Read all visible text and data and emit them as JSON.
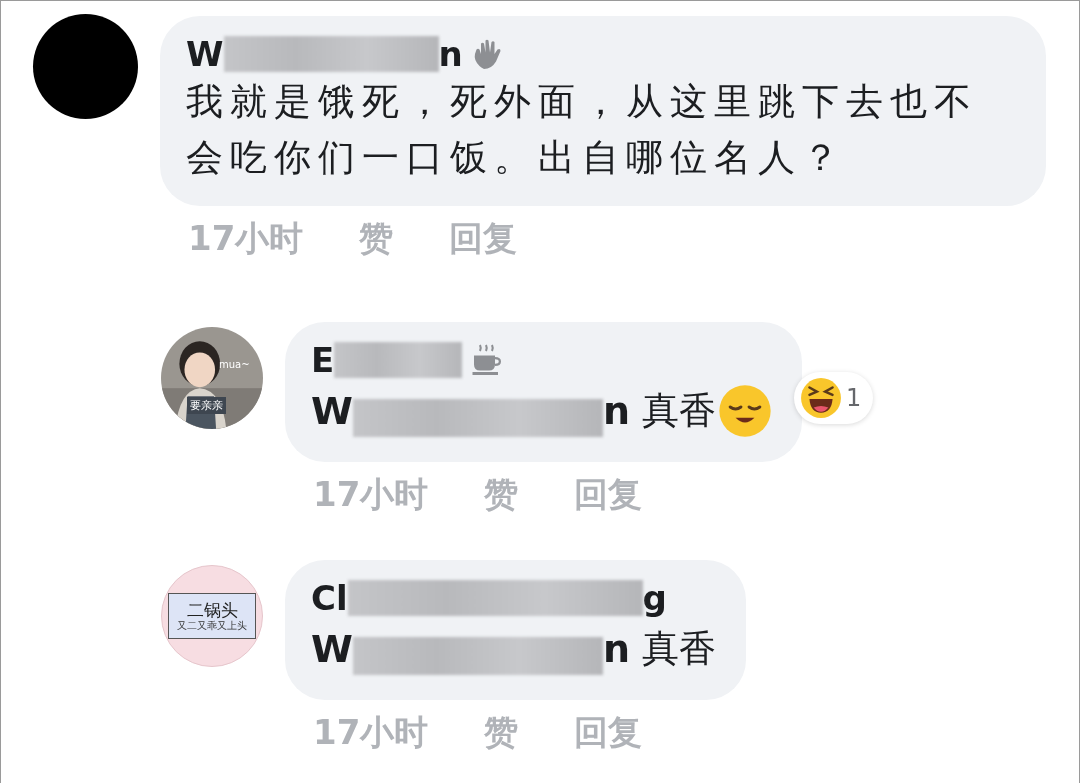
{
  "comments": [
    {
      "avatar": {
        "kind": "blank"
      },
      "reply": false,
      "name": {
        "start": "W",
        "end": "n"
      },
      "badge": {
        "kind": "wave"
      },
      "body": {
        "kind": "text",
        "text": "我就是饿死，死外面，从这里跳下去也不会吃你们一口饭。出自哪位名人？"
      },
      "meta": {
        "time": "17小时",
        "like": "赞",
        "reply": "回复"
      }
    },
    {
      "avatar": {
        "kind": "picture",
        "caption": "mua~",
        "tag": "要亲亲"
      },
      "reply": true,
      "name": {
        "start": "E"
      },
      "badge": {
        "kind": "cup"
      },
      "body": {
        "kind": "mention",
        "start": "W",
        "end": "n",
        "text": "真香",
        "emoji": {
          "kind": "relieved"
        }
      },
      "reaction": {
        "kind": "laugh",
        "count": "1"
      },
      "meta": {
        "time": "17小时",
        "like": "赞",
        "reply": "回复"
      }
    },
    {
      "avatar": {
        "kind": "logo",
        "title": "二锅头",
        "subtitle": "又二又乖又上头"
      },
      "reply": true,
      "name": {
        "start": "Cl",
        "end": "g"
      },
      "body": {
        "kind": "mention",
        "start": "W",
        "end": "n",
        "text": "真香"
      },
      "meta": {
        "time": "17小时",
        "like": "赞",
        "reply": "回复"
      }
    }
  ]
}
